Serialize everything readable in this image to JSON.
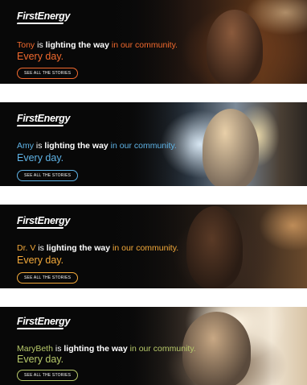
{
  "brand": "FirstEnergy",
  "banners": [
    {
      "name": "Tony",
      "highlight": "lighting the way",
      "suffix": " in our community.",
      "tagline": "Every day.",
      "button": "SEE ALL THE STORIES",
      "accent": "#f26a2e"
    },
    {
      "name": "Amy",
      "highlight": "lighting the way",
      "suffix": " in our community.",
      "tagline": "Every day.",
      "button": "SEE ALL THE STORIES",
      "accent": "#5fb3e6"
    },
    {
      "name": "Dr. V",
      "highlight": "lighting the way",
      "suffix": " in our community.",
      "tagline": "Every day.",
      "button": "SEE ALL THE STORIES",
      "accent": "#f3a93a"
    },
    {
      "name": "MaryBeth",
      "highlight": "lighting the way",
      "suffix": " in our community.",
      "tagline": "Every day.",
      "button": "SEE ALL THE STORIES",
      "accent": "#b7c96a"
    }
  ]
}
